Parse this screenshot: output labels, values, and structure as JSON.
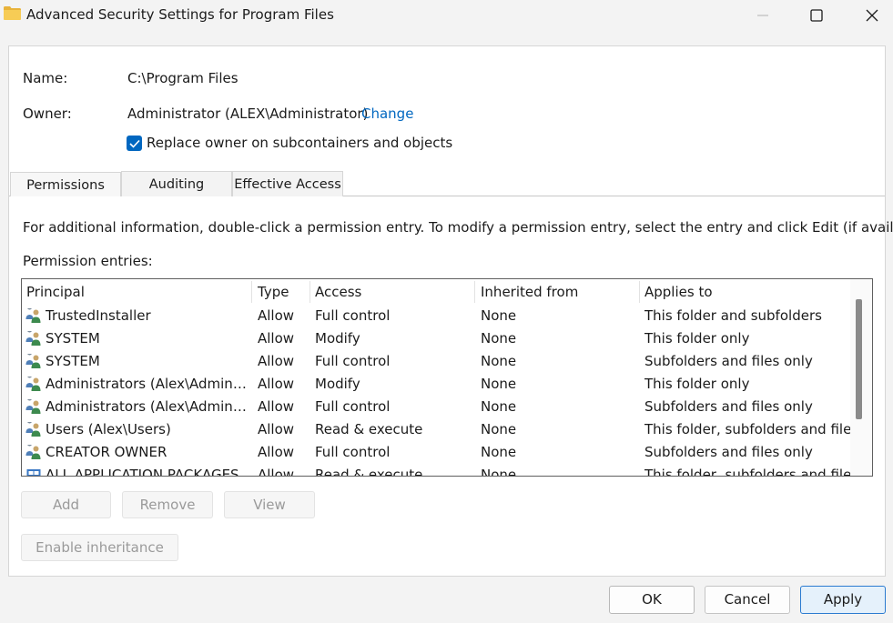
{
  "window": {
    "title": "Advanced Security Settings for Program Files",
    "icon": "folder-icon"
  },
  "details": {
    "name_label": "Name:",
    "name_value": "C:\\Program Files",
    "owner_label": "Owner:",
    "owner_value": "Administrator (ALEX\\Administrator)",
    "change_link": "Change",
    "replace_owner_label": "Replace owner on subcontainers and objects",
    "replace_owner_checked": true
  },
  "tabs": [
    {
      "label": "Permissions",
      "active": true
    },
    {
      "label": "Auditing",
      "active": false
    },
    {
      "label": "Effective Access",
      "active": false
    }
  ],
  "permissions": {
    "info_text": "For additional information, double-click a permission entry. To modify a permission entry, select the entry and click Edit (if available).",
    "entries_label": "Permission entries:",
    "columns": [
      "Principal",
      "Type",
      "Access",
      "Inherited from",
      "Applies to"
    ],
    "rows": [
      {
        "icon": "users-icon",
        "principal": "TrustedInstaller",
        "type": "Allow",
        "access": "Full control",
        "inherited": "None",
        "applies": "This folder and subfolders"
      },
      {
        "icon": "users-icon",
        "principal": "SYSTEM",
        "type": "Allow",
        "access": "Modify",
        "inherited": "None",
        "applies": "This folder only"
      },
      {
        "icon": "users-icon",
        "principal": "SYSTEM",
        "type": "Allow",
        "access": "Full control",
        "inherited": "None",
        "applies": "Subfolders and files only"
      },
      {
        "icon": "users-icon",
        "principal": "Administrators (Alex\\Administr...",
        "type": "Allow",
        "access": "Modify",
        "inherited": "None",
        "applies": "This folder only"
      },
      {
        "icon": "users-icon",
        "principal": "Administrators (Alex\\Administr...",
        "type": "Allow",
        "access": "Full control",
        "inherited": "None",
        "applies": "Subfolders and files only"
      },
      {
        "icon": "users-icon",
        "principal": "Users (Alex\\Users)",
        "type": "Allow",
        "access": "Read & execute",
        "inherited": "None",
        "applies": "This folder, subfolders and files"
      },
      {
        "icon": "users-icon",
        "principal": "CREATOR OWNER",
        "type": "Allow",
        "access": "Full control",
        "inherited": "None",
        "applies": "Subfolders and files only"
      },
      {
        "icon": "package-icon",
        "principal": "ALL APPLICATION PACKAGES",
        "type": "Allow",
        "access": "Read & execute",
        "inherited": "None",
        "applies": "This folder, subfolders and files"
      }
    ]
  },
  "actions": {
    "add": "Add",
    "remove": "Remove",
    "view": "View",
    "enable_inheritance": "Enable inheritance"
  },
  "dialog_buttons": {
    "ok": "OK",
    "cancel": "Cancel",
    "apply": "Apply"
  },
  "colors": {
    "accent": "#0067c0",
    "link": "#0067c0"
  }
}
